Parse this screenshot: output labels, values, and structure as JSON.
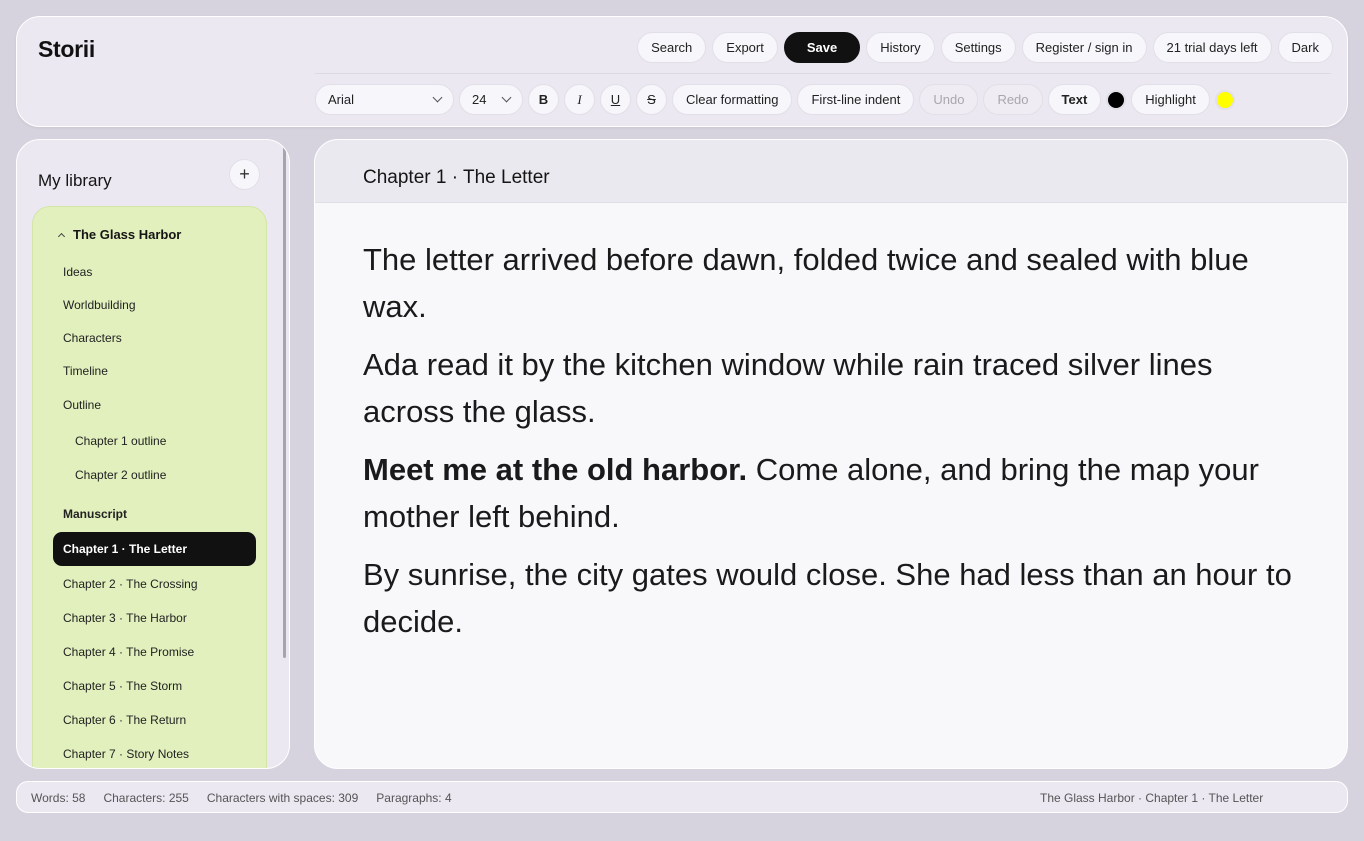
{
  "app": {
    "name": "Storii"
  },
  "top_actions": [
    "Search",
    "Export",
    "Save",
    "History",
    "Settings",
    "Register / sign in",
    "21 trial days left",
    "Dark"
  ],
  "format_bar": {
    "font": "Arial",
    "size": "24",
    "bold": "B",
    "italic": "I",
    "underline": "U",
    "strike": "S",
    "clear": "Clear formatting",
    "indent": "First-line indent",
    "undo": "Undo",
    "redo": "Redo",
    "text_label": "Text",
    "text_color": "#000000",
    "highlight_label": "Highlight",
    "highlight_color": "#ffff00"
  },
  "sidebar": {
    "title": "My library",
    "add_symbol": "+",
    "project": {
      "name": "The Glass Harbor",
      "items": [
        {
          "label": "Ideas"
        },
        {
          "label": "Worldbuilding"
        },
        {
          "label": "Characters"
        },
        {
          "label": "Timeline"
        },
        {
          "label": "Outline"
        },
        {
          "label": "Chapter 1 outline"
        },
        {
          "label": "Chapter 2 outline"
        },
        {
          "label": "Manuscript"
        },
        {
          "label": "Chapter 1 · The Letter"
        },
        {
          "label": "Chapter 2 · The Crossing"
        },
        {
          "label": "Chapter 3 · The Harbor"
        },
        {
          "label": "Chapter 4 · The Promise"
        },
        {
          "label": "Chapter 5 · The Storm"
        },
        {
          "label": "Chapter 6 · The Return"
        },
        {
          "label": "Chapter 7 · Story Notes"
        }
      ]
    }
  },
  "editor": {
    "chapter_title": "Chapter 1 · The Letter",
    "paragraphs": [
      {
        "text": "The letter arrived before dawn, folded twice and sealed with blue wax."
      },
      {
        "text": "Ada read it by the kitchen window while rain traced silver lines across the glass."
      },
      {
        "bold": "Meet me at the old harbor.",
        "text": " Come alone, and bring the map your mother left behind."
      },
      {
        "text": "By sunrise, the city gates would close. She had less than an hour to decide."
      }
    ]
  },
  "status": {
    "words": "Words: 58",
    "characters": "Characters: 255",
    "characters_spaces": "Characters with spaces: 309",
    "paragraphs": "Paragraphs: 4",
    "breadcrumb": "The Glass Harbor · Chapter 1 · The Letter"
  }
}
